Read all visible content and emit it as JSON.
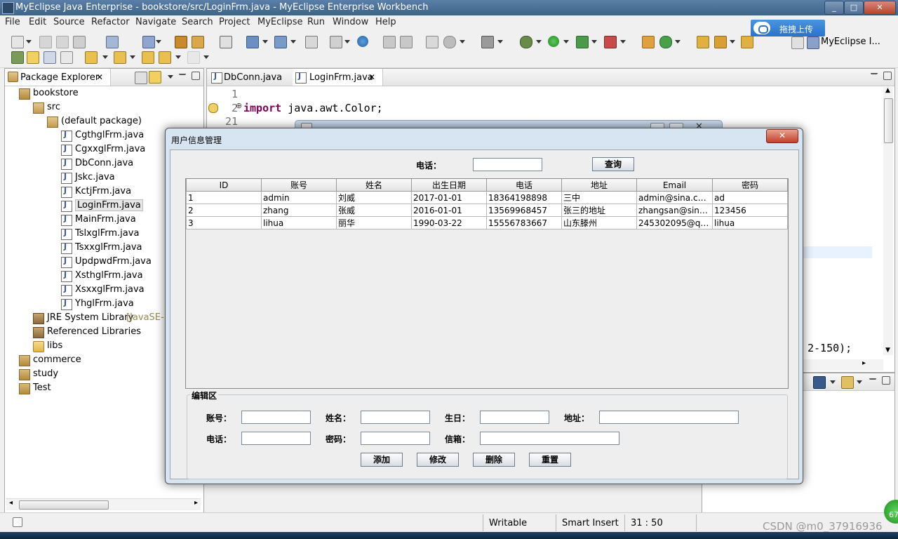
{
  "window": {
    "title": "MyEclipse Java Enterprise - bookstore/src/LoginFrm.java - MyEclipse Enterprise Workbench"
  },
  "menu": [
    "File",
    "Edit",
    "Source",
    "Refactor",
    "Navigate",
    "Search",
    "Project",
    "MyEclipse",
    "Run",
    "Window",
    "Help"
  ],
  "baidu": {
    "label": "拖拽上传"
  },
  "perspective": {
    "label": "MyEclipse I..."
  },
  "package_explorer": {
    "tab_label": "Package Explorer",
    "tree": [
      {
        "label": "bookstore",
        "type": "proj"
      },
      {
        "label": "src",
        "type": "pkg"
      },
      {
        "label": "(default package)",
        "type": "pkg"
      },
      {
        "label": "CgthglFrm.java",
        "type": "java"
      },
      {
        "label": "CgxxglFrm.java",
        "type": "java"
      },
      {
        "label": "DbConn.java",
        "type": "java"
      },
      {
        "label": "Jskc.java",
        "type": "java"
      },
      {
        "label": "KctjFrm.java",
        "type": "java"
      },
      {
        "label": "LoginFrm.java",
        "type": "java"
      },
      {
        "label": "MainFrm.java",
        "type": "java"
      },
      {
        "label": "TslxglFrm.java",
        "type": "java"
      },
      {
        "label": "TsxxglFrm.java",
        "type": "java"
      },
      {
        "label": "UpdpwdFrm.java",
        "type": "java"
      },
      {
        "label": "XsthglFrm.java",
        "type": "java"
      },
      {
        "label": "XsxxglFrm.java",
        "type": "java"
      },
      {
        "label": "YhglFrm.java",
        "type": "java"
      },
      {
        "label": "JRE System Library",
        "suffix": "[JavaSE-1",
        "type": "lib"
      },
      {
        "label": "Referenced Libraries",
        "type": "lib"
      },
      {
        "label": "libs",
        "type": "folder"
      },
      {
        "label": "commerce",
        "type": "proj"
      },
      {
        "label": "study",
        "type": "proj"
      },
      {
        "label": "Test",
        "type": "proj"
      }
    ]
  },
  "editor": {
    "tabs": [
      "DbConn.java",
      "LoginFrm.java"
    ],
    "line_numbers": [
      "1",
      "2",
      "21"
    ],
    "line2_keyword": "import",
    "line2_rest": " java.awt.Color;",
    "partial_code": "2-150);"
  },
  "status_bar": {
    "mode": "Writable",
    "insert": "Smart Insert",
    "position": "31 : 50"
  },
  "watermark": "CSDN @m0_37916936",
  "badge": "67",
  "dialog": {
    "title": "用户信息管理",
    "search_label": "电话：",
    "search_value": "",
    "query_button": "查询",
    "table": {
      "headers": [
        "ID",
        "账号",
        "姓名",
        "出生日期",
        "电话",
        "地址",
        "Email",
        "密码"
      ],
      "rows": [
        [
          "1",
          "admin",
          "刘威",
          "2017-01-01",
          "18364198898",
          "三中",
          "admin@sina.com",
          "ad"
        ],
        [
          "2",
          "zhang",
          "张威",
          "2016-01-01",
          "13569968457",
          "张三的地址",
          "zhangsan@sina....",
          "123456"
        ],
        [
          "3",
          "lihua",
          "丽华",
          "1990-03-22",
          "15556783667",
          "山东滕州",
          "245302095@qq....",
          "lihua"
        ]
      ]
    },
    "edit_section": {
      "legend": "编辑区",
      "labels": {
        "account": "账号：",
        "name": "姓名：",
        "birthday": "生日：",
        "address": "地址：",
        "phone": "电话：",
        "password": "密码：",
        "email": "信箱："
      },
      "buttons": {
        "add": "添加",
        "modify": "修改",
        "delete": "删除",
        "reset": "重置"
      }
    }
  }
}
